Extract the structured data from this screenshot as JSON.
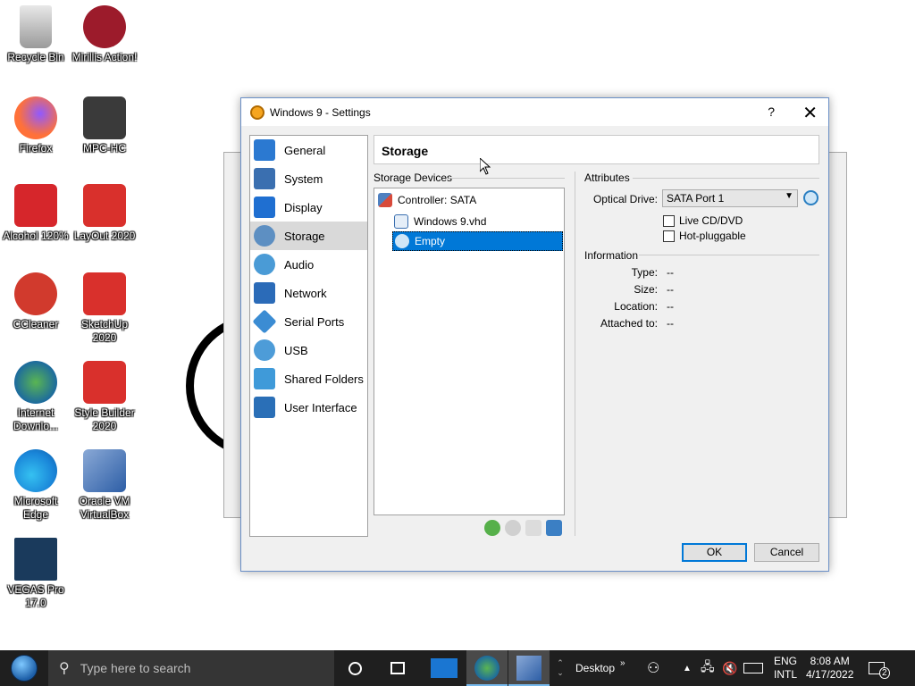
{
  "desktop": {
    "icons": [
      {
        "label": "Recycle Bin",
        "color": "#c0c0c0"
      },
      {
        "label": "Mirillis Action!",
        "color": "#9c1b2b"
      },
      {
        "label": "Firefox",
        "color": "#ff7139"
      },
      {
        "label": "MPC-HC",
        "color": "#3a3a3a"
      },
      {
        "label": "Alcohol 120%",
        "color": "#d6262b"
      },
      {
        "label": "LayOut 2020",
        "color": "#d9302c"
      },
      {
        "label": "CCleaner",
        "color": "#d13a2d"
      },
      {
        "label": "SketchUp 2020",
        "color": "#d9302c"
      },
      {
        "label": "Internet Downlo...",
        "color": "#2e8b3e"
      },
      {
        "label": "Style Builder 2020",
        "color": "#d9302c"
      },
      {
        "label": "Microsoft Edge",
        "color": "#1a86d9"
      },
      {
        "label": "Oracle VM VirtualBox",
        "color": "#2d5ea6"
      },
      {
        "label": "VEGAS Pro 17.0",
        "color": "#1a3a5c"
      }
    ]
  },
  "dialog": {
    "title": "Windows 9 - Settings",
    "help": "?",
    "close": "✕",
    "nav": [
      {
        "label": "General",
        "color": "#2b79d1"
      },
      {
        "label": "System",
        "color": "#3a6fb0"
      },
      {
        "label": "Display",
        "color": "#1f6fd1"
      },
      {
        "label": "Storage",
        "color": "#5d8fc2"
      },
      {
        "label": "Audio",
        "color": "#4a9bd6"
      },
      {
        "label": "Network",
        "color": "#2b6bb8"
      },
      {
        "label": "Serial Ports",
        "color": "#3b8cd3"
      },
      {
        "label": "USB",
        "color": "#4d9cd8"
      },
      {
        "label": "Shared Folders",
        "color": "#3f9ad9"
      },
      {
        "label": "User Interface",
        "color": "#2a6fb7"
      }
    ],
    "header": "Storage",
    "storage_devices_label": "Storage Devices",
    "tree": {
      "controller": "Controller: SATA",
      "disk": "Windows 9.vhd",
      "optical": "Empty"
    },
    "attributes_label": "Attributes",
    "optical_drive_label": "Optical Drive:",
    "optical_drive_value": "SATA Port 1",
    "live_cd": "Live CD/DVD",
    "hot_pluggable": "Hot-pluggable",
    "information_label": "Information",
    "info": [
      {
        "label": "Type:",
        "value": "--"
      },
      {
        "label": "Size:",
        "value": "--"
      },
      {
        "label": "Location:",
        "value": "--"
      },
      {
        "label": "Attached to:",
        "value": "--"
      }
    ],
    "ok": "OK",
    "cancel": "Cancel"
  },
  "taskbar": {
    "search_placeholder": "Type here to search",
    "desktop_label": "Desktop",
    "lang1": "ENG",
    "lang2": "INTL",
    "time": "8:08 AM",
    "date": "4/17/2022",
    "notification_count": "2"
  },
  "colors": {
    "selection": "#0078d7",
    "taskbar": "#1f1f1f"
  }
}
